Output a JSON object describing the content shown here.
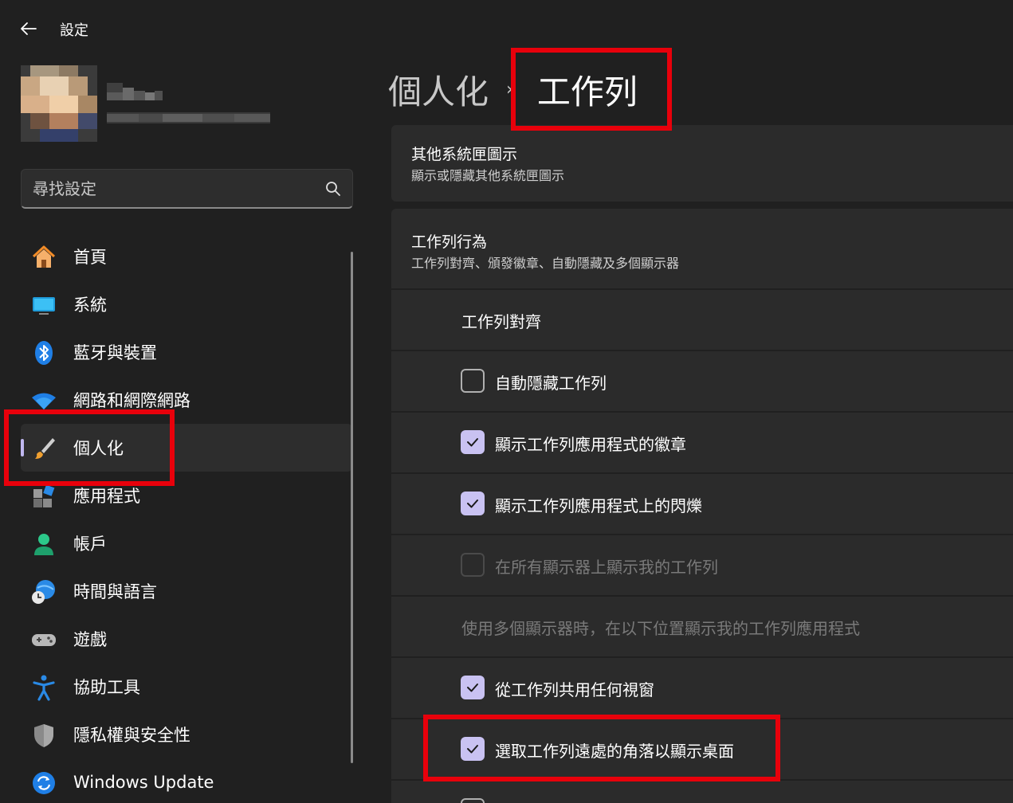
{
  "app": {
    "title": "設定"
  },
  "search": {
    "placeholder": "尋找設定"
  },
  "nav": {
    "items": [
      {
        "label": "首頁",
        "icon": "home-icon"
      },
      {
        "label": "系統",
        "icon": "monitor-icon"
      },
      {
        "label": "藍牙與裝置",
        "icon": "bluetooth-icon"
      },
      {
        "label": "網路和網際網路",
        "icon": "wifi-icon"
      },
      {
        "label": "個人化",
        "icon": "paintbrush-icon",
        "active": true
      },
      {
        "label": "應用程式",
        "icon": "apps-icon"
      },
      {
        "label": "帳戶",
        "icon": "person-icon"
      },
      {
        "label": "時間與語言",
        "icon": "globe-clock-icon"
      },
      {
        "label": "遊戲",
        "icon": "gamepad-icon"
      },
      {
        "label": "協助工具",
        "icon": "accessibility-icon"
      },
      {
        "label": "隱私權與安全性",
        "icon": "shield-icon"
      },
      {
        "label": "Windows Update",
        "icon": "update-icon"
      }
    ]
  },
  "breadcrumb": {
    "parent": "個人化",
    "separator": "›",
    "current": "工作列"
  },
  "cards": {
    "tray": {
      "title": "其他系統匣圖示",
      "subtitle": "顯示或隱藏其他系統匣圖示"
    },
    "behavior": {
      "title": "工作列行為",
      "subtitle": "工作列對齊、頒發徽章、自動隱藏及多個顯示器"
    }
  },
  "rows": {
    "alignment": {
      "label": "工作列對齊"
    },
    "autohide": {
      "label": "自動隱藏工作列",
      "checked": false
    },
    "badges": {
      "label": "顯示工作列應用程式的徽章",
      "checked": true
    },
    "flashing": {
      "label": "顯示工作列應用程式上的閃爍",
      "checked": true
    },
    "all_displays": {
      "label": "在所有顯示器上顯示我的工作列",
      "checked": false,
      "enabled": false
    },
    "multi_display": {
      "label": "使用多個顯示器時，在以下位置顯示我的工作列應用程式"
    },
    "share_window": {
      "label": "從工作列共用任何視窗",
      "checked": true
    },
    "far_corner": {
      "label": "選取工作列遠處的角落以顯示桌面",
      "checked": true
    }
  },
  "colors": {
    "accent": "#c9c2f2",
    "highlight": "#e8000b",
    "background": "#202020",
    "card": "#2b2b2b"
  }
}
